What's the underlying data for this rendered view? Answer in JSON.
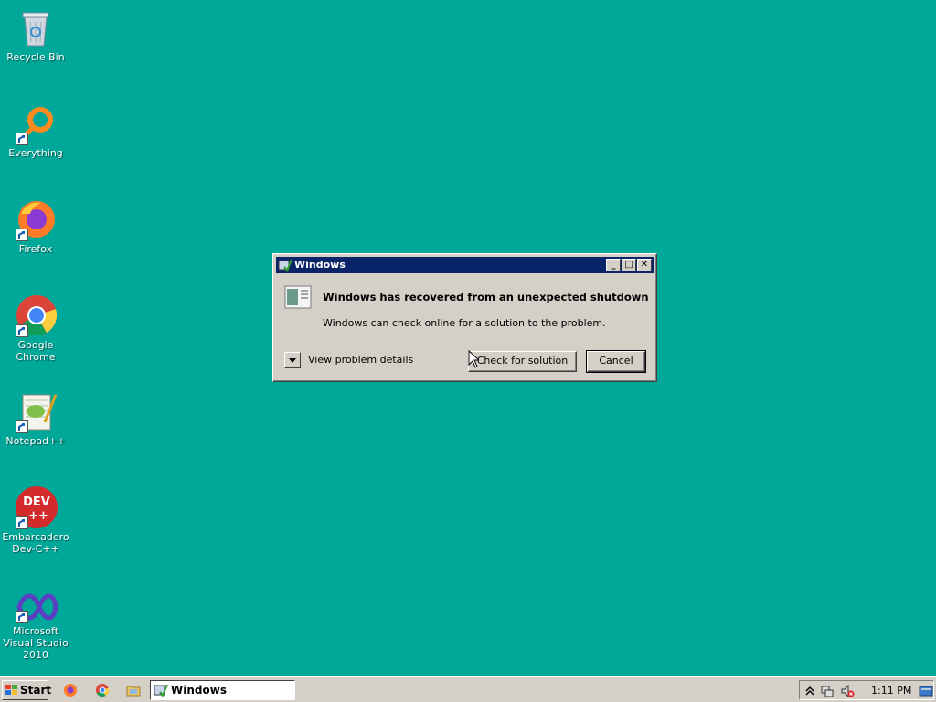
{
  "desktop": {
    "background": "#00A89A",
    "icons": [
      {
        "label": "Recycle Bin",
        "icon": "recycle-bin-icon"
      },
      {
        "label": "Everything",
        "icon": "everything-search-icon"
      },
      {
        "label": "Firefox",
        "icon": "firefox-icon"
      },
      {
        "label": "Google Chrome",
        "icon": "chrome-icon"
      },
      {
        "label": "Notepad++",
        "icon": "notepadpp-icon"
      },
      {
        "label": "Embarcadero Dev-C++",
        "icon": "devcpp-icon"
      },
      {
        "label": "Microsoft Visual Studio 2010",
        "icon": "visual-studio-icon"
      }
    ]
  },
  "dialog": {
    "title": "Windows",
    "heading": "Windows has recovered from an unexpected shutdown",
    "subtext": "Windows can check online for a solution to the problem.",
    "details_label": "View problem details",
    "check_button": "Check for solution",
    "cancel_button": "Cancel",
    "title_color": "#0A246A"
  },
  "taskbar": {
    "start_label": "Start",
    "quick_launch": [
      "firefox-icon",
      "chrome-icon",
      "file-explorer-icon"
    ],
    "task_label": "Windows",
    "clock": "1:11 PM"
  }
}
